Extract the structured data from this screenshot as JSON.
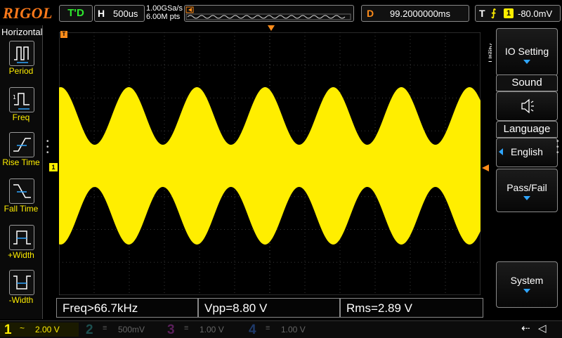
{
  "brand": "RIGOL",
  "top": {
    "run_state": "T'D",
    "horizontal_letter": "H",
    "timebase": "500us",
    "sample_rate": "1.00GSa/s",
    "memory_depth": "6.00M pts",
    "delay_letter": "D",
    "delay": "99.2000000ms",
    "trigger_letter": "T",
    "trigger_source": "1",
    "trigger_level": "-80.0mV"
  },
  "left_menu": {
    "title": "Horizontal",
    "items": [
      {
        "label": "Period",
        "icon": "period-icon"
      },
      {
        "label": "Freq",
        "icon": "frequency-icon"
      },
      {
        "label": "Rise Time",
        "icon": "rise-time-icon"
      },
      {
        "label": "Fall Time",
        "icon": "fall-time-icon"
      },
      {
        "label": "+Width",
        "icon": "positive-width-icon"
      },
      {
        "label": "-Width",
        "icon": "negative-width-icon"
      }
    ]
  },
  "right_menu": {
    "side_label": "Utility",
    "io_setting": "IO Setting",
    "sound_title": "Sound",
    "language_title": "Language",
    "language_value": "English",
    "pass_fail": "Pass/Fail",
    "system": "System"
  },
  "measurements": {
    "freq": "Freq>66.7kHz",
    "vpp": "Vpp=8.80 V",
    "rms": "Rms=2.89 V"
  },
  "channels": [
    {
      "num": "1",
      "scale": "2.00 V",
      "color": "#ffee00",
      "active": true
    },
    {
      "num": "2",
      "scale": "500mV",
      "color": "#00e0e0",
      "active": false
    },
    {
      "num": "3",
      "scale": "1.00 V",
      "color": "#ff44ff",
      "active": false
    },
    {
      "num": "4",
      "scale": "1.00 V",
      "color": "#3a7bff",
      "active": false
    }
  ],
  "colors": {
    "waveform": "#ffee00",
    "accent_orange": "#ff8c1a",
    "run_green": "#2ee82e",
    "menu_arrow": "#2fa6ff"
  },
  "markers": {
    "channel1_ground": "1",
    "trigger_position": "T"
  }
}
